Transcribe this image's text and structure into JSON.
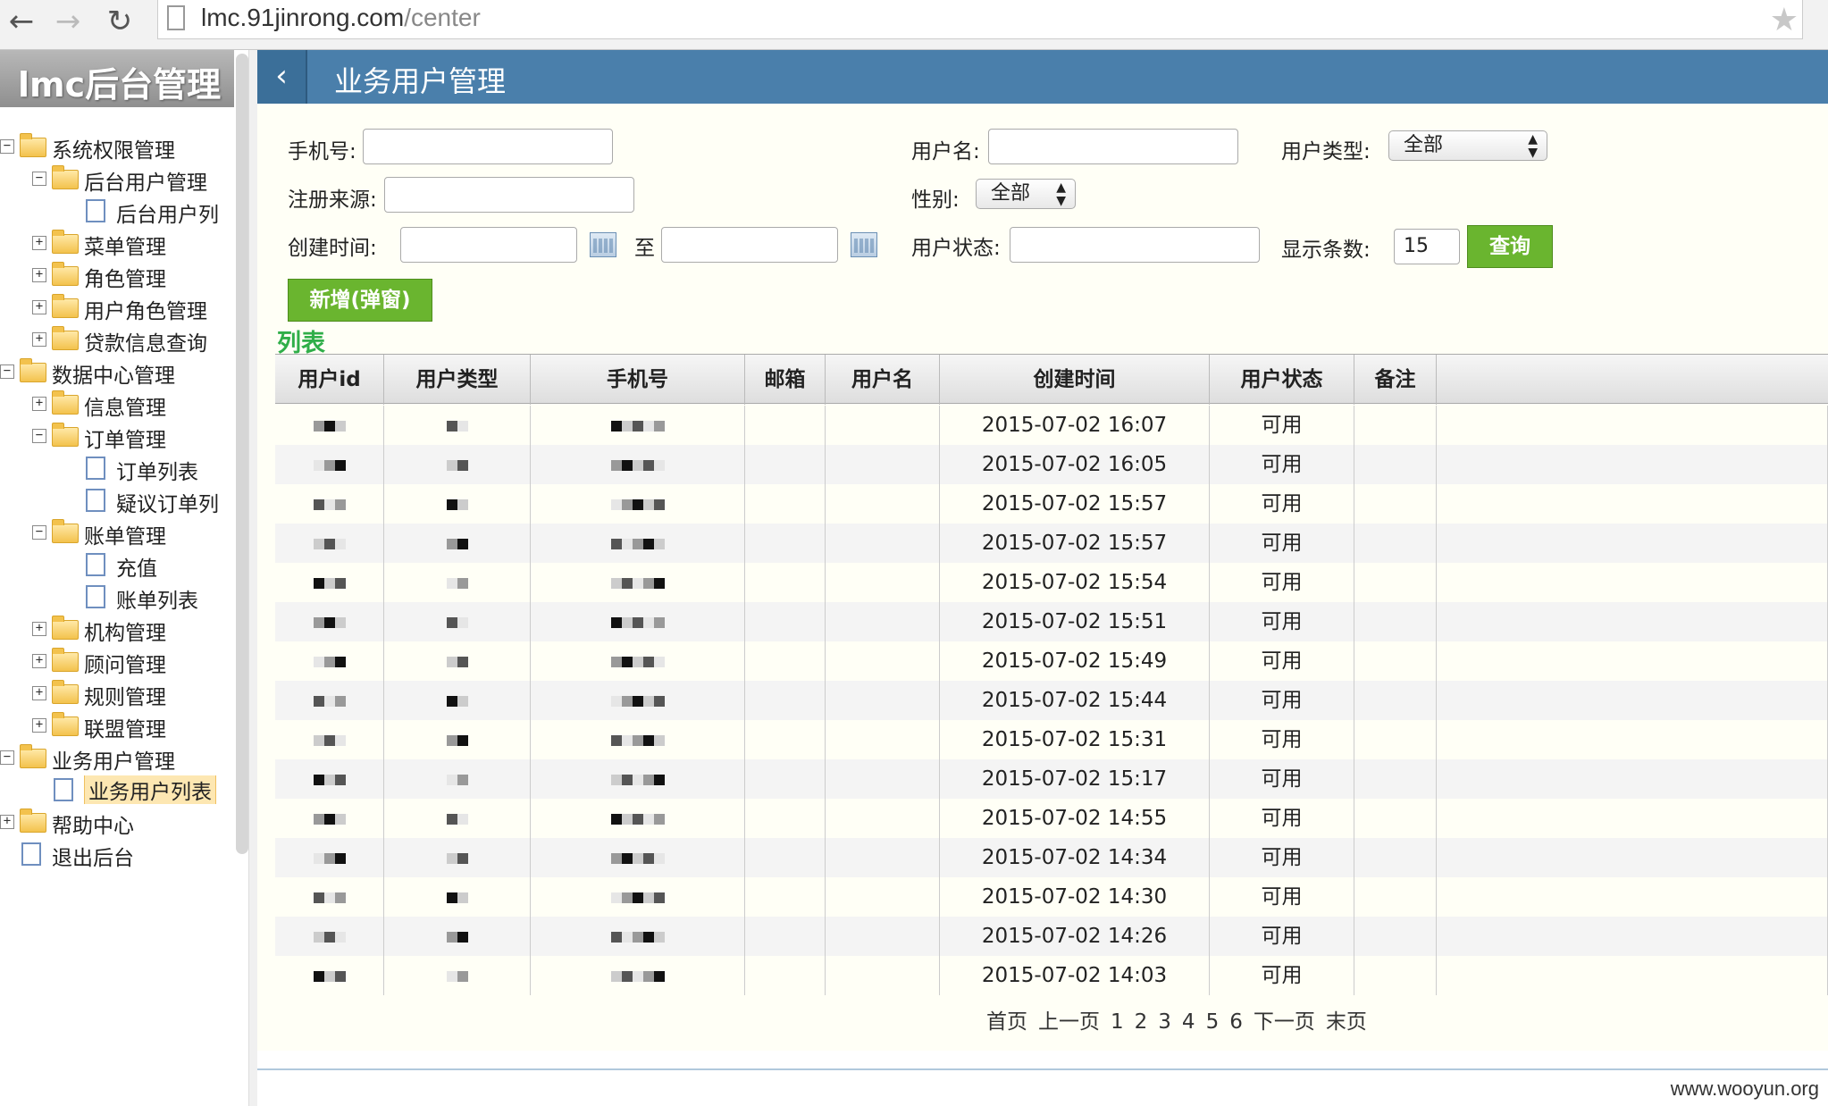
{
  "browser": {
    "url_host": "lmc.91jinrong.com",
    "url_path": "/center"
  },
  "sidebar": {
    "title": "lmc后台管理",
    "tree": [
      {
        "label": "系统权限管理",
        "type": "folder",
        "level": 0,
        "toggle": "−"
      },
      {
        "label": "后台用户管理",
        "type": "folder",
        "level": 1,
        "toggle": "−"
      },
      {
        "label": "后台用户列",
        "type": "file",
        "level": 2,
        "toggle": ""
      },
      {
        "label": "菜单管理",
        "type": "folder",
        "level": 1,
        "toggle": "+"
      },
      {
        "label": "角色管理",
        "type": "folder",
        "level": 1,
        "toggle": "+"
      },
      {
        "label": "用户角色管理",
        "type": "folder",
        "level": 1,
        "toggle": "+"
      },
      {
        "label": "贷款信息查询",
        "type": "folder",
        "level": 1,
        "toggle": "+"
      },
      {
        "label": "数据中心管理",
        "type": "folder",
        "level": 0,
        "toggle": "−"
      },
      {
        "label": "信息管理",
        "type": "folder",
        "level": 1,
        "toggle": "+"
      },
      {
        "label": "订单管理",
        "type": "folder",
        "level": 1,
        "toggle": "−"
      },
      {
        "label": "订单列表",
        "type": "file",
        "level": 2,
        "toggle": ""
      },
      {
        "label": "疑议订单列",
        "type": "file",
        "level": 2,
        "toggle": ""
      },
      {
        "label": "账单管理",
        "type": "folder",
        "level": 1,
        "toggle": "−"
      },
      {
        "label": "充值",
        "type": "file",
        "level": 2,
        "toggle": ""
      },
      {
        "label": "账单列表",
        "type": "file",
        "level": 2,
        "toggle": ""
      },
      {
        "label": "机构管理",
        "type": "folder",
        "level": 1,
        "toggle": "+"
      },
      {
        "label": "顾问管理",
        "type": "folder",
        "level": 1,
        "toggle": "+"
      },
      {
        "label": "规则管理",
        "type": "folder",
        "level": 1,
        "toggle": "+"
      },
      {
        "label": "联盟管理",
        "type": "folder",
        "level": 1,
        "toggle": "+"
      },
      {
        "label": "业务用户管理",
        "type": "folder",
        "level": 0,
        "toggle": "−"
      },
      {
        "label": "业务用户列表",
        "type": "file",
        "level": 1,
        "toggle": "",
        "selected": true
      },
      {
        "label": "帮助中心",
        "type": "folder",
        "level": 0,
        "toggle": "+"
      },
      {
        "label": "退出后台",
        "type": "file",
        "level": 0,
        "toggle": ""
      }
    ]
  },
  "header": {
    "back_glyph": "‹",
    "title": "业务用户管理"
  },
  "filters": {
    "phone_label": "手机号:",
    "username_label": "用户名:",
    "user_type_label": "用户类型:",
    "user_type_value": "全部",
    "source_label": "注册来源:",
    "gender_label": "性别:",
    "gender_value": "全部",
    "created_label": "创建时间:",
    "to_label": "至",
    "status_label": "用户状态:",
    "page_size_label": "显示条数:",
    "page_size_value": "15",
    "query_button": "查询",
    "add_button": "新增(弹窗)"
  },
  "list_title": "列表",
  "table": {
    "columns": [
      "用户id",
      "用户类型",
      "手机号",
      "邮箱",
      "用户名",
      "创建时间",
      "用户状态",
      "备注"
    ],
    "rows": [
      {
        "created": "2015-07-02 16:07",
        "status": "可用"
      },
      {
        "created": "2015-07-02 16:05",
        "status": "可用"
      },
      {
        "created": "2015-07-02 15:57",
        "status": "可用"
      },
      {
        "created": "2015-07-02 15:57",
        "status": "可用"
      },
      {
        "created": "2015-07-02 15:54",
        "status": "可用"
      },
      {
        "created": "2015-07-02 15:51",
        "status": "可用"
      },
      {
        "created": "2015-07-02 15:49",
        "status": "可用"
      },
      {
        "created": "2015-07-02 15:44",
        "status": "可用"
      },
      {
        "created": "2015-07-02 15:31",
        "status": "可用"
      },
      {
        "created": "2015-07-02 15:17",
        "status": "可用"
      },
      {
        "created": "2015-07-02 14:55",
        "status": "可用"
      },
      {
        "created": "2015-07-02 14:34",
        "status": "可用"
      },
      {
        "created": "2015-07-02 14:30",
        "status": "可用"
      },
      {
        "created": "2015-07-02 14:26",
        "status": "可用"
      },
      {
        "created": "2015-07-02 14:03",
        "status": "可用"
      }
    ]
  },
  "pager": {
    "first": "首页",
    "prev": "上一页",
    "pages": [
      "1",
      "2",
      "3",
      "4",
      "5",
      "6"
    ],
    "next": "下一页",
    "last": "末页"
  },
  "watermark": "www.wooyun.org",
  "colors": {
    "header_blue": "#4a7fab",
    "accent_green": "#6ab52f",
    "list_title_green": "#2fae49"
  }
}
